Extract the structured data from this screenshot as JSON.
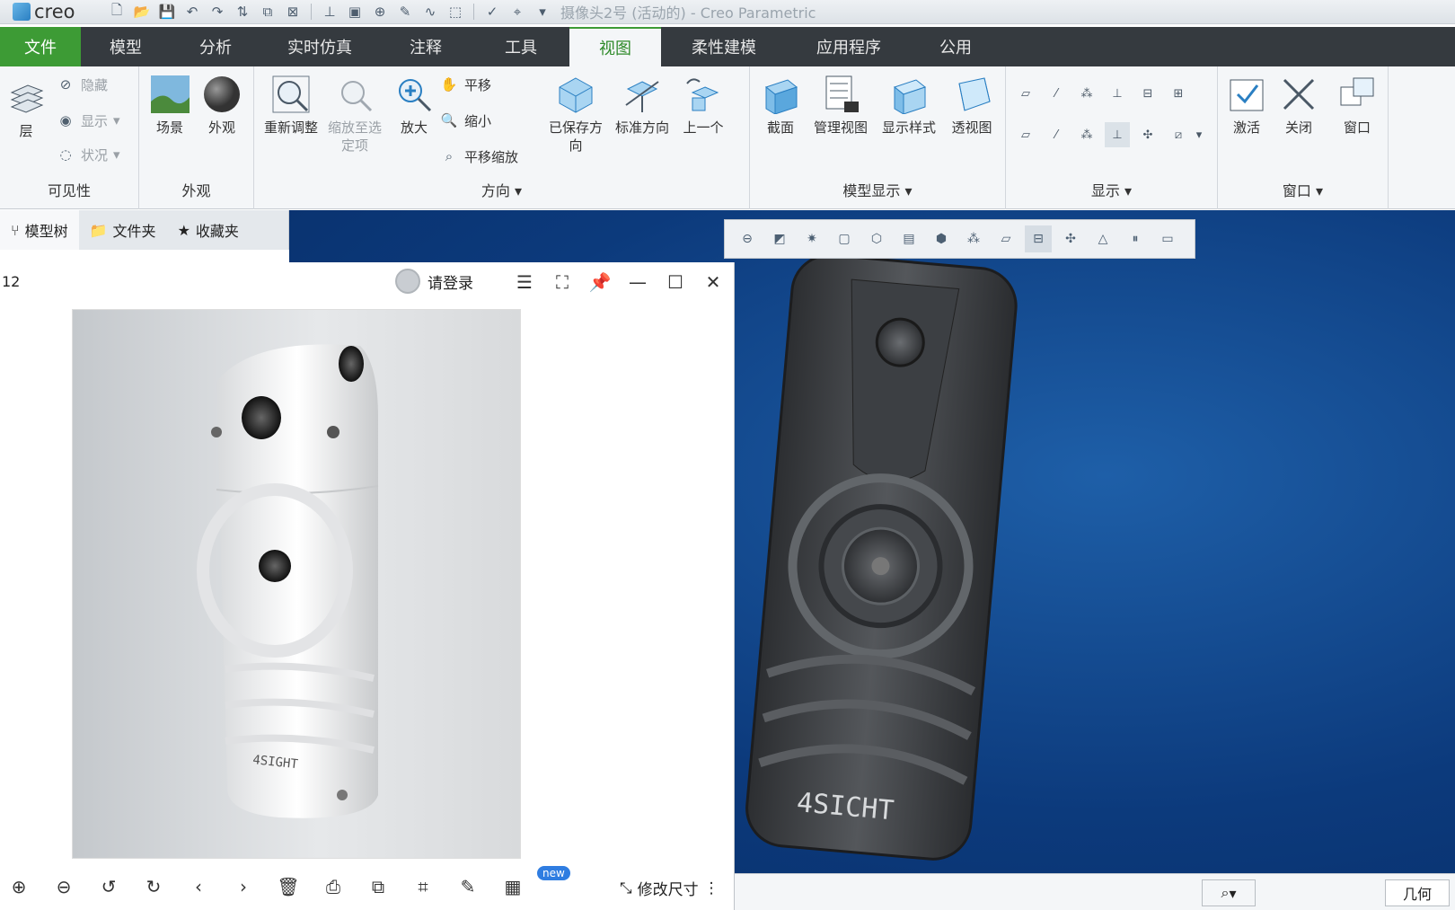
{
  "app": {
    "logo": "creo",
    "window_title": "摄像头2号 (活动的) - Creo Parametric"
  },
  "tabs": [
    "文件",
    "模型",
    "分析",
    "实时仿真",
    "注释",
    "工具",
    "视图",
    "柔性建模",
    "应用程序",
    "公用"
  ],
  "ribbon": {
    "visibility": {
      "label": "可见性",
      "layer": "层",
      "hide": "隐藏",
      "show": "显示",
      "status": "状况"
    },
    "appearance": {
      "label": "外观",
      "scene": "场景",
      "appearance": "外观"
    },
    "orientation": {
      "label": "方向",
      "refit": "重新调整",
      "zoom_to_selected": "缩放至选定项",
      "zoom_in": "放大",
      "pan": "平移",
      "zoom_out": "缩小",
      "pan_zoom": "平移缩放",
      "saved_orient": "已保存方向",
      "standard_orient": "标准方向",
      "previous": "上一个"
    },
    "model_display": {
      "label": "模型显示",
      "section": "截面",
      "manage_views": "管理视图",
      "display_style": "显示样式",
      "perspective": "透视图"
    },
    "show": {
      "label": "显示"
    },
    "window": {
      "label": "窗口",
      "activate": "激活",
      "close": "关闭",
      "windows": "窗口"
    }
  },
  "nav": {
    "model_tree": "模型树",
    "folder": "文件夹",
    "favorites": "收藏夹"
  },
  "viewer": {
    "index": "12",
    "login": "请登录",
    "new_badge": "new",
    "modify_size": "修改尺寸",
    "photo_brand": "4SIGHT"
  },
  "model": {
    "brand": "4SICHT"
  },
  "status": {
    "geometry": "几何"
  },
  "colors": {
    "accent_green": "#3d9b35",
    "tab_bar": "#353a3f",
    "canvas_blue": "#0c3a7c"
  }
}
